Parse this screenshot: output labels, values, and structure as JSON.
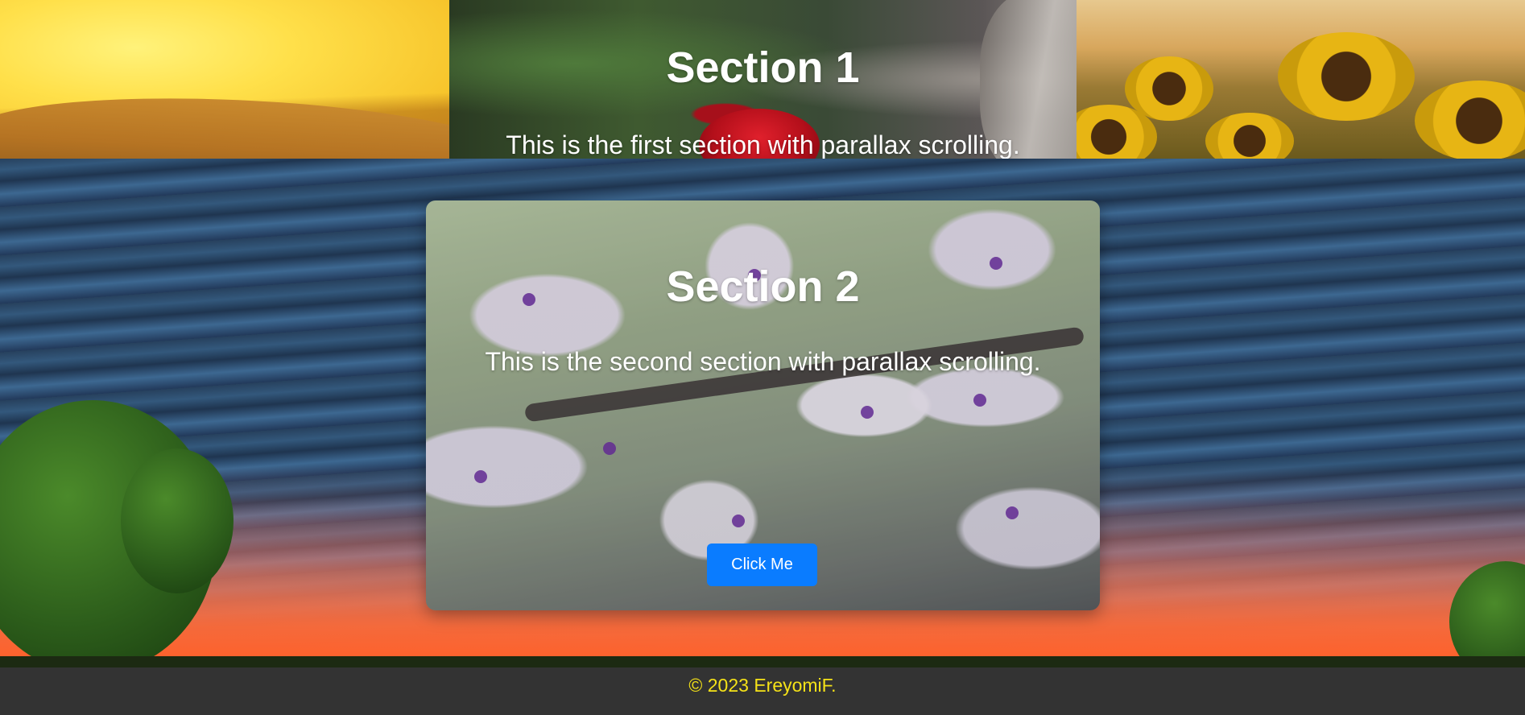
{
  "section1": {
    "heading": "Section 1",
    "text": "This is the first section with parallax scrolling."
  },
  "section2": {
    "heading": "Section 2",
    "text": "This is the second section with parallax scrolling.",
    "button_label": "Click Me"
  },
  "footer": {
    "text": "© 2023 EreyomiF."
  },
  "colors": {
    "button": "#0a7cff",
    "footer_bg": "#333333",
    "footer_text": "#f5e218",
    "heading_text": "#ffffff"
  }
}
